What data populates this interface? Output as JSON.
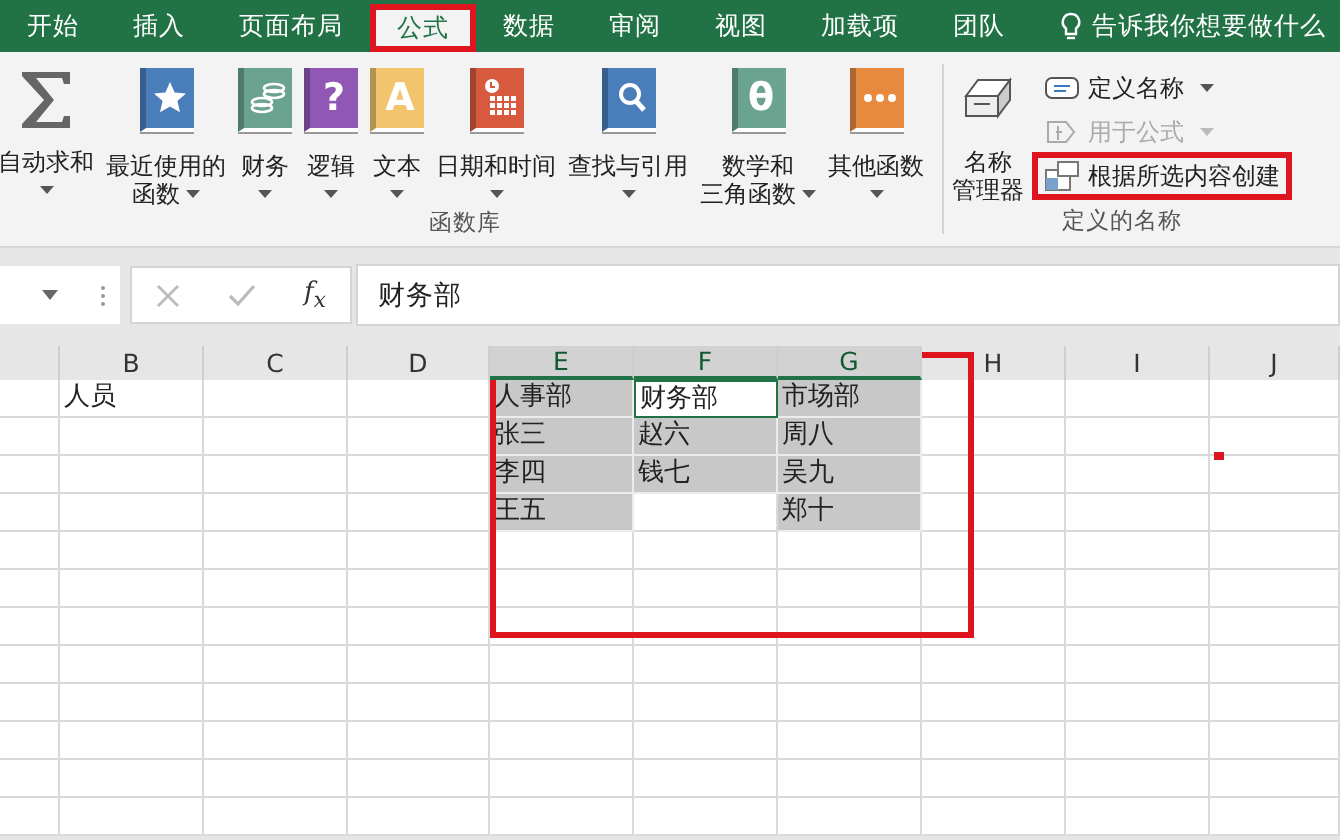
{
  "tabs": [
    {
      "label": "开始",
      "selected": false,
      "highlighted": false
    },
    {
      "label": "插入",
      "selected": false,
      "highlighted": false
    },
    {
      "label": "页面布局",
      "selected": false,
      "highlighted": false
    },
    {
      "label": "公式",
      "selected": true,
      "highlighted": true
    },
    {
      "label": "数据",
      "selected": false,
      "highlighted": false
    },
    {
      "label": "审阅",
      "selected": false,
      "highlighted": false
    },
    {
      "label": "视图",
      "selected": false,
      "highlighted": false
    },
    {
      "label": "加载项",
      "selected": false,
      "highlighted": false
    },
    {
      "label": "团队",
      "selected": false,
      "highlighted": false
    }
  ],
  "tell_me": "告诉我你想要做什么",
  "function_library": {
    "label": "函数库",
    "commands": [
      {
        "kind": "sum",
        "lines": [
          "自动求和"
        ],
        "dropdown": true
      },
      {
        "kind": "star",
        "color": "#4a7ebb",
        "lines": [
          "最近使用的",
          "函数"
        ],
        "dropdown": true
      },
      {
        "kind": "coins",
        "color": "#6ba391",
        "lines": [
          "财务"
        ],
        "dropdown": true
      },
      {
        "kind": "glyph",
        "glyph": "?",
        "color": "#9058b4",
        "lines": [
          "逻辑"
        ],
        "dropdown": true
      },
      {
        "kind": "glyph",
        "glyph": "A",
        "color": "#f1c46d",
        "lines": [
          "文本"
        ],
        "dropdown": true
      },
      {
        "kind": "calendar",
        "color": "#d85a3e",
        "lines": [
          "日期和时间"
        ],
        "dropdown": true
      },
      {
        "kind": "search",
        "color": "#4a7ebb",
        "lines": [
          "查找与引用"
        ],
        "dropdown": true
      },
      {
        "kind": "glyph",
        "glyph": "θ",
        "color": "#6ba391",
        "lines": [
          "数学和",
          "三角函数"
        ],
        "dropdown": true
      },
      {
        "kind": "more",
        "color": "#e88a3e",
        "lines": [
          "其他函数"
        ],
        "dropdown": true
      }
    ]
  },
  "defined_names": {
    "label": "定义的名称",
    "manager": {
      "lines": [
        "名称",
        "管理器"
      ]
    },
    "commands": [
      {
        "kind": "define",
        "label": "定义名称",
        "dropdown": true,
        "disabled": false,
        "highlighted": false
      },
      {
        "kind": "use",
        "label": "用于公式",
        "dropdown": true,
        "disabled": true,
        "highlighted": false
      },
      {
        "kind": "create",
        "label": "根据所选内容创建",
        "dropdown": false,
        "disabled": false,
        "highlighted": true
      }
    ]
  },
  "formula_bar": {
    "fx": "f$_{x}$",
    "value": "财务部"
  },
  "sheet": {
    "columns": [
      {
        "label": "B",
        "selected": false,
        "cells": [
          {
            "text": "人员",
            "selected": false,
            "active": false
          }
        ]
      },
      {
        "label": "C",
        "selected": false
      },
      {
        "label": "D",
        "selected": false
      },
      {
        "label": "E",
        "selected": true,
        "cells": [
          {
            "text": "人事部",
            "selected": true,
            "active": false
          },
          {
            "text": "张三",
            "selected": true,
            "active": false
          },
          {
            "text": "李四",
            "selected": true,
            "active": false
          },
          {
            "text": "王五",
            "selected": true,
            "active": false
          }
        ]
      },
      {
        "label": "F",
        "selected": true,
        "cells": [
          {
            "text": "财务部",
            "selected": true,
            "active": true
          },
          {
            "text": "赵六",
            "selected": true,
            "active": false
          },
          {
            "text": "钱七",
            "selected": true,
            "active": false
          }
        ]
      },
      {
        "label": "G",
        "selected": true,
        "cells": [
          {
            "text": "市场部",
            "selected": true,
            "active": false
          },
          {
            "text": "周八",
            "selected": true,
            "active": false
          },
          {
            "text": "吴九",
            "selected": true,
            "active": false
          },
          {
            "text": "郑十",
            "selected": true,
            "active": false
          }
        ]
      },
      {
        "label": "H",
        "selected": false
      },
      {
        "label": "I",
        "selected": false
      },
      {
        "label": "J",
        "selected": false
      }
    ],
    "highlight_frame": true,
    "error_mark": true
  }
}
